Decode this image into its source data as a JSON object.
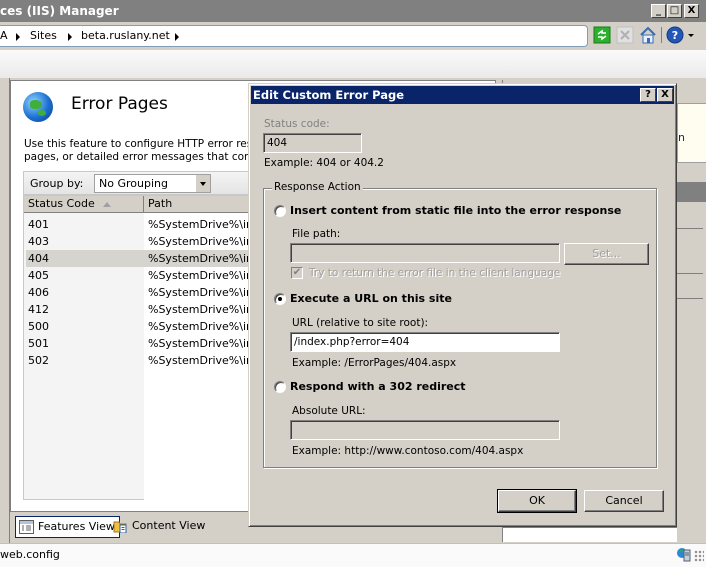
{
  "window": {
    "title": "ces (IIS) Manager",
    "controls": {
      "minimize": "_",
      "maximize": "□",
      "close": "X"
    }
  },
  "address": {
    "crumbs": [
      "A",
      "Sites",
      "beta.ruslany.net"
    ],
    "toolbar_icons": [
      "refresh-icon",
      "stop-icon",
      "home-icon",
      "help-icon"
    ]
  },
  "feature": {
    "title": "Error Pages",
    "description_line1": "Use this feature to configure HTTP error respo",
    "description_line2": "pages, or detailed error messages that contair",
    "group_by_label": "Group by:",
    "group_by_value": "No Grouping",
    "columns": [
      "Status Code",
      "Path"
    ],
    "rows": [
      {
        "code": "401",
        "path": "%SystemDrive%\\ine",
        "selected": false
      },
      {
        "code": "403",
        "path": "%SystemDrive%\\ine",
        "selected": false
      },
      {
        "code": "404",
        "path": "%SystemDrive%\\ine",
        "selected": true
      },
      {
        "code": "405",
        "path": "%SystemDrive%\\ine",
        "selected": false
      },
      {
        "code": "406",
        "path": "%SystemDrive%\\ine",
        "selected": false
      },
      {
        "code": "412",
        "path": "%SystemDrive%\\ine",
        "selected": false
      },
      {
        "code": "500",
        "path": "%SystemDrive%\\ine",
        "selected": false
      },
      {
        "code": "501",
        "path": "%SystemDrive%\\ine",
        "selected": false
      },
      {
        "code": "502",
        "path": "%SystemDrive%\\ine",
        "selected": false
      }
    ]
  },
  "views": {
    "features": "Features View",
    "content": "Content View"
  },
  "status": {
    "text": "web.config"
  },
  "actions_pane": {
    "partial_text": "n"
  },
  "dialog": {
    "title": "Edit Custom Error Page",
    "help_btn": "?",
    "close_btn": "X",
    "status_code_label": "Status code:",
    "status_code_value": "404",
    "status_code_example": "Example: 404 or 404.2",
    "response_action_legend": "Response Action",
    "option_static": "Insert content from static file into the error response",
    "file_path_label": "File path:",
    "file_path_value": "",
    "set_button": "Set...",
    "localize_checkbox": "Try to return the error file in the client language",
    "localize_checked": true,
    "option_execute": "Execute a URL on this site",
    "url_label": "URL (relative to site root):",
    "url_value": "/index.php?error=404",
    "url_example": "Example: /ErrorPages/404.aspx",
    "option_redirect": "Respond with a 302 redirect",
    "absolute_url_label": "Absolute URL:",
    "absolute_url_value": "",
    "absolute_url_example": "Example: http://www.contoso.com/404.aspx",
    "selected_option": "execute",
    "ok": "OK",
    "cancel": "Cancel"
  }
}
